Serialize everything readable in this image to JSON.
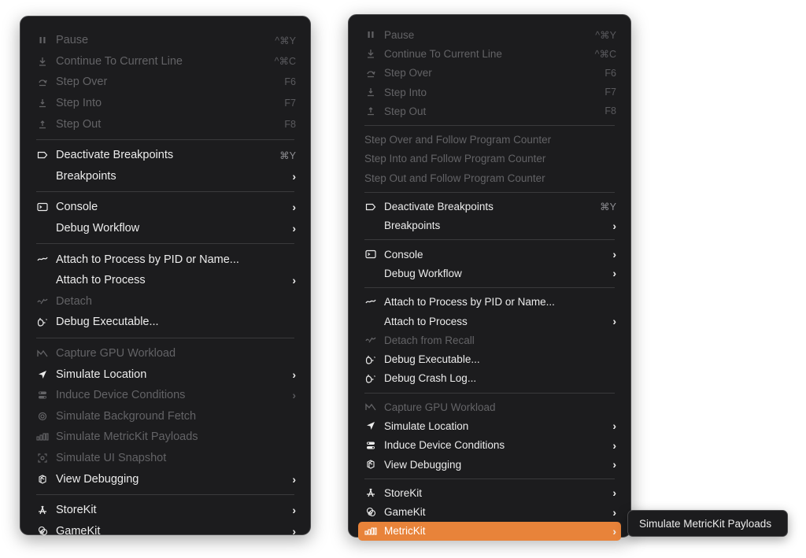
{
  "left_menu": {
    "items": [
      {
        "type": "item",
        "id": "pause",
        "label": "Pause",
        "shortcut": "^⌘Y",
        "icon": "pause-icon",
        "disabled": true
      },
      {
        "type": "item",
        "id": "continue-to-current-line",
        "label": "Continue To Current Line",
        "shortcut": "^⌘C",
        "icon": "continue-icon",
        "disabled": true
      },
      {
        "type": "item",
        "id": "step-over",
        "label": "Step Over",
        "shortcut": "F6",
        "icon": "step-over-icon",
        "disabled": true
      },
      {
        "type": "item",
        "id": "step-into",
        "label": "Step Into",
        "shortcut": "F7",
        "icon": "step-into-icon",
        "disabled": true
      },
      {
        "type": "item",
        "id": "step-out",
        "label": "Step Out",
        "shortcut": "F8",
        "icon": "step-out-icon",
        "disabled": true
      },
      {
        "type": "separator"
      },
      {
        "type": "item",
        "id": "deactivate-breakpoints",
        "label": "Deactivate Breakpoints",
        "shortcut": "⌘Y",
        "icon": "breakpoint-icon",
        "disabled": false
      },
      {
        "type": "item",
        "id": "breakpoints",
        "label": "Breakpoints",
        "icon": "",
        "submenu": true,
        "disabled": false
      },
      {
        "type": "separator"
      },
      {
        "type": "item",
        "id": "console",
        "label": "Console",
        "icon": "console-icon",
        "submenu": true,
        "disabled": false
      },
      {
        "type": "item",
        "id": "debug-workflow",
        "label": "Debug Workflow",
        "icon": "",
        "submenu": true,
        "disabled": false
      },
      {
        "type": "separator"
      },
      {
        "type": "item",
        "id": "attach-by-pid",
        "label": "Attach to Process by PID or Name...",
        "icon": "attach-icon",
        "disabled": false
      },
      {
        "type": "item",
        "id": "attach-to-process",
        "label": "Attach to Process",
        "icon": "",
        "submenu": true,
        "disabled": false
      },
      {
        "type": "item",
        "id": "detach",
        "label": "Detach",
        "icon": "detach-icon",
        "disabled": true
      },
      {
        "type": "item",
        "id": "debug-executable",
        "label": "Debug Executable...",
        "icon": "debug-executable-icon",
        "disabled": false
      },
      {
        "type": "separator"
      },
      {
        "type": "item",
        "id": "capture-gpu-workload",
        "label": "Capture GPU Workload",
        "icon": "gpu-icon",
        "disabled": true
      },
      {
        "type": "item",
        "id": "simulate-location",
        "label": "Simulate Location",
        "icon": "location-icon",
        "submenu": true,
        "disabled": false
      },
      {
        "type": "item",
        "id": "induce-device-conditions",
        "label": "Induce Device Conditions",
        "icon": "device-conditions-icon",
        "submenu": true,
        "disabled": true
      },
      {
        "type": "item",
        "id": "simulate-background-fetch",
        "label": "Simulate Background Fetch",
        "icon": "background-fetch-icon",
        "disabled": true
      },
      {
        "type": "item",
        "id": "simulate-metrickit-payloads",
        "label": "Simulate MetricKit Payloads",
        "icon": "metrickit-icon",
        "disabled": true
      },
      {
        "type": "item",
        "id": "simulate-ui-snapshot",
        "label": "Simulate UI Snapshot",
        "icon": "ui-snapshot-icon",
        "disabled": true
      },
      {
        "type": "item",
        "id": "view-debugging",
        "label": "View Debugging",
        "icon": "view-debugging-icon",
        "submenu": true,
        "disabled": false
      },
      {
        "type": "separator"
      },
      {
        "type": "item",
        "id": "storekit",
        "label": "StoreKit",
        "icon": "storekit-icon",
        "submenu": true,
        "disabled": false
      },
      {
        "type": "item",
        "id": "gamekit",
        "label": "GameKit",
        "icon": "gamekit-icon",
        "submenu": true,
        "disabled": false
      }
    ]
  },
  "right_menu": {
    "items": [
      {
        "type": "item",
        "id": "pause",
        "label": "Pause",
        "shortcut": "^⌘Y",
        "icon": "pause-icon",
        "disabled": true
      },
      {
        "type": "item",
        "id": "continue-to-current-line",
        "label": "Continue To Current Line",
        "shortcut": "^⌘C",
        "icon": "continue-icon",
        "disabled": true
      },
      {
        "type": "item",
        "id": "step-over",
        "label": "Step Over",
        "shortcut": "F6",
        "icon": "step-over-icon",
        "disabled": true
      },
      {
        "type": "item",
        "id": "step-into",
        "label": "Step Into",
        "shortcut": "F7",
        "icon": "step-into-icon",
        "disabled": true
      },
      {
        "type": "item",
        "id": "step-out",
        "label": "Step Out",
        "shortcut": "F8",
        "icon": "step-out-icon",
        "disabled": true
      },
      {
        "type": "separator"
      },
      {
        "type": "item",
        "id": "step-over-follow-pc",
        "label": "Step Over and Follow Program Counter",
        "disabled": true,
        "plain": true
      },
      {
        "type": "item",
        "id": "step-into-follow-pc",
        "label": "Step Into and Follow Program Counter",
        "disabled": true,
        "plain": true
      },
      {
        "type": "item",
        "id": "step-out-follow-pc",
        "label": "Step Out and Follow Program Counter",
        "disabled": true,
        "plain": true
      },
      {
        "type": "separator"
      },
      {
        "type": "item",
        "id": "deactivate-breakpoints",
        "label": "Deactivate Breakpoints",
        "shortcut": "⌘Y",
        "icon": "breakpoint-icon",
        "disabled": false
      },
      {
        "type": "item",
        "id": "breakpoints",
        "label": "Breakpoints",
        "icon": "",
        "submenu": true,
        "disabled": false
      },
      {
        "type": "separator"
      },
      {
        "type": "item",
        "id": "console",
        "label": "Console",
        "icon": "console-icon",
        "submenu": true,
        "disabled": false
      },
      {
        "type": "item",
        "id": "debug-workflow",
        "label": "Debug Workflow",
        "icon": "",
        "submenu": true,
        "disabled": false
      },
      {
        "type": "separator"
      },
      {
        "type": "item",
        "id": "attach-by-pid",
        "label": "Attach to Process by PID or Name...",
        "icon": "attach-icon",
        "disabled": false
      },
      {
        "type": "item",
        "id": "attach-to-process",
        "label": "Attach to Process",
        "icon": "",
        "submenu": true,
        "disabled": false
      },
      {
        "type": "item",
        "id": "detach-from-recall",
        "label": "Detach from Recall",
        "icon": "detach-icon",
        "disabled": true
      },
      {
        "type": "item",
        "id": "debug-executable",
        "label": "Debug Executable...",
        "icon": "debug-executable-icon",
        "disabled": false
      },
      {
        "type": "item",
        "id": "debug-crash-log",
        "label": "Debug Crash Log...",
        "icon": "debug-executable-icon",
        "disabled": false
      },
      {
        "type": "separator"
      },
      {
        "type": "item",
        "id": "capture-gpu-workload",
        "label": "Capture GPU Workload",
        "icon": "gpu-icon",
        "disabled": true
      },
      {
        "type": "item",
        "id": "simulate-location",
        "label": "Simulate Location",
        "icon": "location-icon",
        "submenu": true,
        "disabled": false
      },
      {
        "type": "item",
        "id": "induce-device-conditions",
        "label": "Induce Device Conditions",
        "icon": "device-conditions-icon",
        "submenu": true,
        "disabled": false
      },
      {
        "type": "item",
        "id": "view-debugging",
        "label": "View Debugging",
        "icon": "view-debugging-icon",
        "submenu": true,
        "disabled": false
      },
      {
        "type": "separator"
      },
      {
        "type": "item",
        "id": "storekit",
        "label": "StoreKit",
        "icon": "storekit-icon",
        "submenu": true,
        "disabled": false
      },
      {
        "type": "item",
        "id": "gamekit",
        "label": "GameKit",
        "icon": "gamekit-icon",
        "submenu": true,
        "disabled": false
      },
      {
        "type": "item",
        "id": "metrickit",
        "label": "MetricKit",
        "icon": "metrickit-icon",
        "submenu": true,
        "disabled": false,
        "highlighted": true
      }
    ]
  },
  "submenu": {
    "label": "Simulate MetricKit Payloads"
  },
  "colors": {
    "menu_bg": "#1c1c1e",
    "highlight": "#e8833a",
    "text": "#ececec",
    "disabled_text": "#636366",
    "separator": "#3a3a3c"
  }
}
